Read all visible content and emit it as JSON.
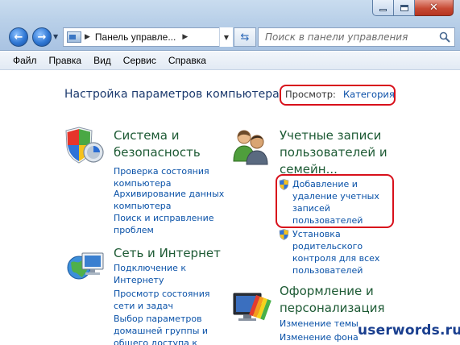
{
  "window": {
    "controls": {
      "minimize_icon": "minimize-icon",
      "maximize_icon": "maximize-icon",
      "close_icon": "close-icon",
      "close_glyph": "✕"
    }
  },
  "toolbar": {
    "back_icon": "back-arrow-icon",
    "forward_icon": "forward-arrow-icon",
    "address_text": "Панель управле...",
    "search_placeholder": "Поиск в панели управления"
  },
  "menu": {
    "items": [
      "Файл",
      "Правка",
      "Вид",
      "Сервис",
      "Справка"
    ]
  },
  "content": {
    "title": "Настройка параметров компьютера",
    "view_label": "Просмотр:",
    "view_value": "Категория",
    "categories": [
      {
        "heading_lines": [
          "Система и",
          "безопасность"
        ],
        "icon": "security-shield-icon",
        "tasks": [
          [
            "Проверка состояния",
            "компьютера"
          ],
          [
            "Архивирование данных",
            "компьютера"
          ],
          [
            "Поиск и исправление",
            "проблем"
          ]
        ]
      },
      {
        "heading_lines": [
          "Сеть и Интернет"
        ],
        "icon": "network-globe-icon",
        "tasks": [
          [
            "Подключение к",
            "Интернету"
          ],
          [
            "Просмотр состояния",
            "сети и задач"
          ],
          [
            "Выбор параметров",
            "домашней группы и",
            "общего доступа к"
          ]
        ]
      },
      {
        "heading_lines": [
          "Учетные записи",
          "пользователей и",
          "семейн..."
        ],
        "icon": "users-icon",
        "tasks": [
          [
            "Добавление и",
            "удаление учетных",
            "записей",
            "пользователей"
          ],
          [
            "Установка",
            "родительского",
            "контроля для всех",
            "пользователей"
          ]
        ]
      },
      {
        "heading_lines": [
          "Оформление и",
          "персонализация"
        ],
        "icon": "appearance-monitor-icon",
        "tasks": [
          [
            "Изменение темы"
          ],
          [
            "Изменение фона"
          ]
        ]
      }
    ]
  },
  "watermark": "userwords.ru",
  "colors": {
    "accent_link": "#0a52a8",
    "heading_green": "#1d5a34",
    "highlight_red": "#d8101b",
    "title_blue": "#1c3a6e"
  }
}
